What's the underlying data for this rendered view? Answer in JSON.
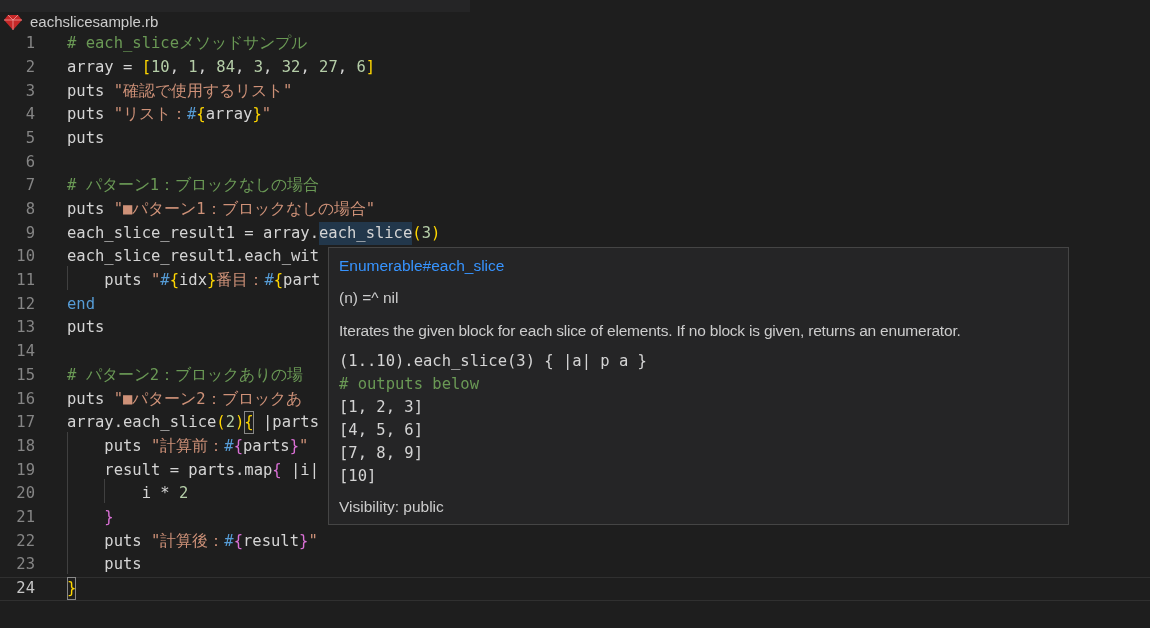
{
  "file_tab": {
    "name": "eachslicesample.rb"
  },
  "lines": [
    {
      "number": "1",
      "current": false,
      "tokens": [
        {
          "kind": "comment",
          "text": "# each_sliceメソッドサンプル"
        }
      ]
    },
    {
      "number": "2",
      "current": false,
      "tokens": [
        {
          "kind": "plain",
          "text": "array = "
        },
        {
          "kind": "bracket1",
          "text": "["
        },
        {
          "kind": "number",
          "text": "10"
        },
        {
          "kind": "plain",
          "text": ", "
        },
        {
          "kind": "number",
          "text": "1"
        },
        {
          "kind": "plain",
          "text": ", "
        },
        {
          "kind": "number",
          "text": "84"
        },
        {
          "kind": "plain",
          "text": ", "
        },
        {
          "kind": "number",
          "text": "3"
        },
        {
          "kind": "plain",
          "text": ", "
        },
        {
          "kind": "number",
          "text": "32"
        },
        {
          "kind": "plain",
          "text": ", "
        },
        {
          "kind": "number",
          "text": "27"
        },
        {
          "kind": "plain",
          "text": ", "
        },
        {
          "kind": "number",
          "text": "6"
        },
        {
          "kind": "bracket1",
          "text": "]"
        }
      ]
    },
    {
      "number": "3",
      "current": false,
      "tokens": [
        {
          "kind": "plain",
          "text": "puts "
        },
        {
          "kind": "string",
          "text": "\"確認で使用するリスト\""
        }
      ]
    },
    {
      "number": "4",
      "current": false,
      "tokens": [
        {
          "kind": "plain",
          "text": "puts "
        },
        {
          "kind": "string",
          "text": "\"リスト："
        },
        {
          "kind": "interp",
          "text": "#"
        },
        {
          "kind": "bracket1",
          "text": "{"
        },
        {
          "kind": "plain",
          "text": "array"
        },
        {
          "kind": "bracket1",
          "text": "}"
        },
        {
          "kind": "string",
          "text": "\""
        }
      ]
    },
    {
      "number": "5",
      "current": false,
      "tokens": [
        {
          "kind": "plain",
          "text": "puts"
        }
      ]
    },
    {
      "number": "6",
      "current": false
    },
    {
      "number": "7",
      "current": false,
      "tokens": [
        {
          "kind": "comment",
          "text": "# パターン1：ブロックなしの場合"
        }
      ]
    },
    {
      "number": "8",
      "current": false,
      "tokens": [
        {
          "kind": "plain",
          "text": "puts "
        },
        {
          "kind": "string",
          "text": "\"■パターン1：ブロックなしの場合\""
        }
      ]
    },
    {
      "number": "9",
      "current": false,
      "tokens": [
        {
          "kind": "plain",
          "text": "each_slice_result1 = array."
        },
        {
          "kind": "hovered",
          "text": "each_slice"
        },
        {
          "kind": "bracket1",
          "text": "("
        },
        {
          "kind": "number",
          "text": "3"
        },
        {
          "kind": "bracket1",
          "text": ")"
        }
      ]
    },
    {
      "number": "10",
      "current": false,
      "tokens": [
        {
          "kind": "plain",
          "text": "each_slice_result1.each_wit"
        }
      ]
    },
    {
      "number": "11",
      "current": false,
      "tokens": [
        {
          "kind": "plain",
          "text": "    puts "
        },
        {
          "kind": "string",
          "text": "\""
        },
        {
          "kind": "interp",
          "text": "#"
        },
        {
          "kind": "bracket1",
          "text": "{"
        },
        {
          "kind": "plain",
          "text": "idx"
        },
        {
          "kind": "bracket1",
          "text": "}"
        },
        {
          "kind": "string",
          "text": "番目："
        },
        {
          "kind": "interp",
          "text": "#"
        },
        {
          "kind": "bracket1",
          "text": "{"
        },
        {
          "kind": "plain",
          "text": "part"
        }
      ]
    },
    {
      "number": "12",
      "current": false,
      "tokens": [
        {
          "kind": "keyword",
          "text": "end"
        }
      ]
    },
    {
      "number": "13",
      "current": false,
      "tokens": [
        {
          "kind": "plain",
          "text": "puts"
        }
      ]
    },
    {
      "number": "14",
      "current": false
    },
    {
      "number": "15",
      "current": false,
      "tokens": [
        {
          "kind": "comment",
          "text": "# パターン2：ブロックありの場"
        }
      ]
    },
    {
      "number": "16",
      "current": false,
      "tokens": [
        {
          "kind": "plain",
          "text": "puts "
        },
        {
          "kind": "string",
          "text": "\"■パターン2：ブロックあ"
        }
      ]
    },
    {
      "number": "17",
      "current": false,
      "tokens": [
        {
          "kind": "plain",
          "text": "array.each_slice"
        },
        {
          "kind": "bracket1",
          "text": "("
        },
        {
          "kind": "number",
          "text": "2"
        },
        {
          "kind": "bracket1",
          "text": ")"
        },
        {
          "kind": "matched",
          "text": "{"
        },
        {
          "kind": "plain",
          "text": " |parts"
        }
      ]
    },
    {
      "number": "18",
      "current": false,
      "tokens": [
        {
          "kind": "plain",
          "text": "    puts "
        },
        {
          "kind": "string",
          "text": "\"計算前："
        },
        {
          "kind": "interp",
          "text": "#"
        },
        {
          "kind": "bracket2",
          "text": "{"
        },
        {
          "kind": "plain",
          "text": "parts"
        },
        {
          "kind": "bracket2",
          "text": "}"
        },
        {
          "kind": "string",
          "text": "\""
        }
      ]
    },
    {
      "number": "19",
      "current": false,
      "tokens": [
        {
          "kind": "plain",
          "text": "    result = parts.map"
        },
        {
          "kind": "bracket2",
          "text": "{"
        },
        {
          "kind": "plain",
          "text": " |i|"
        }
      ]
    },
    {
      "number": "20",
      "current": false,
      "tokens": [
        {
          "kind": "plain",
          "text": "        i * "
        },
        {
          "kind": "number",
          "text": "2"
        }
      ]
    },
    {
      "number": "21",
      "current": false,
      "tokens": [
        {
          "kind": "bracket2",
          "text": "    }"
        }
      ]
    },
    {
      "number": "22",
      "current": false,
      "tokens": [
        {
          "kind": "plain",
          "text": "    puts "
        },
        {
          "kind": "string",
          "text": "\"計算後："
        },
        {
          "kind": "interp",
          "text": "#"
        },
        {
          "kind": "bracket2",
          "text": "{"
        },
        {
          "kind": "plain",
          "text": "result"
        },
        {
          "kind": "bracket2",
          "text": "}"
        },
        {
          "kind": "string",
          "text": "\""
        }
      ]
    },
    {
      "number": "23",
      "current": false,
      "tokens": [
        {
          "kind": "plain",
          "text": "    puts"
        }
      ]
    },
    {
      "number": "24",
      "current": true,
      "tokens": [
        {
          "kind": "matched",
          "text": "}"
        }
      ]
    }
  ],
  "hover": {
    "title": "Enumerable#each_slice",
    "signature": "(n) =^ nil",
    "description": "Iterates the given block for each slice of elements. If no block is given, returns an enumerator.",
    "code": [
      {
        "kind": "plain",
        "text": "(1..10).each_slice(3) { |a| p a }"
      },
      {
        "kind": "comment",
        "text": "# outputs below"
      },
      {
        "kind": "plain",
        "text": "[1, 2, 3]"
      },
      {
        "kind": "plain",
        "text": "[4, 5, 6]"
      },
      {
        "kind": "plain",
        "text": "[7, 8, 9]"
      },
      {
        "kind": "plain",
        "text": "[10]"
      }
    ],
    "visibility": "Visibility: public"
  }
}
